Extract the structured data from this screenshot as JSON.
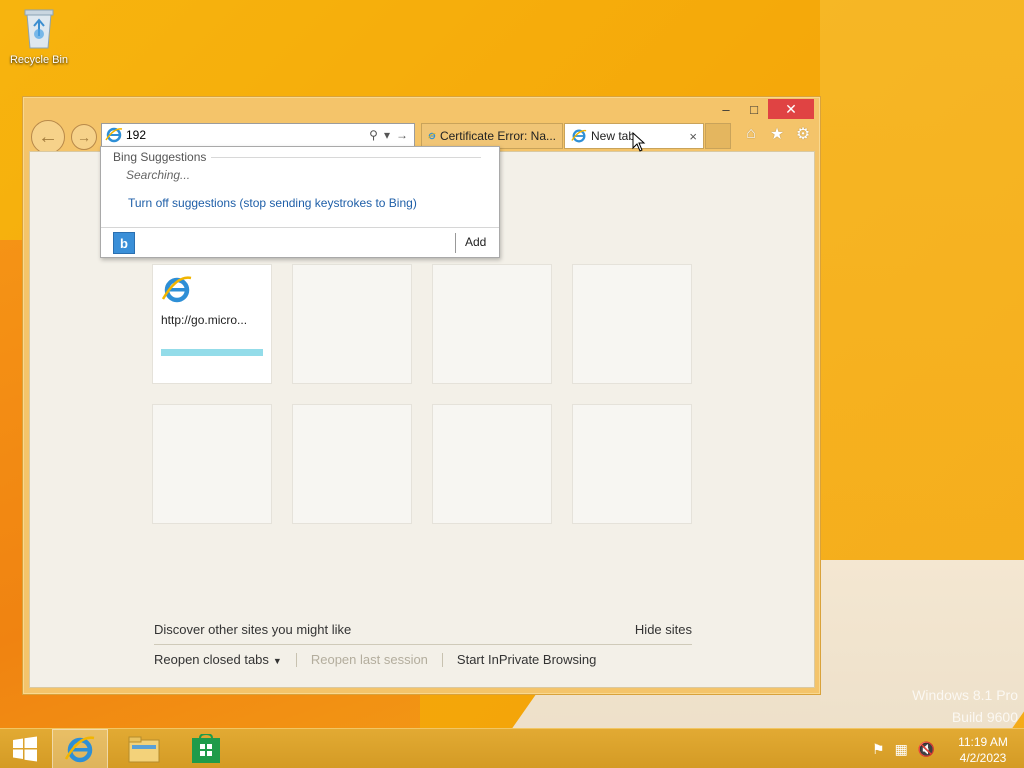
{
  "desktop": {
    "recycle_bin_label": "Recycle Bin",
    "watermark_line1": "Windows 8.1 Pro",
    "watermark_line2": "Build 9600"
  },
  "window": {
    "minimize": "–",
    "maximize": "□",
    "close": "✕"
  },
  "address_bar": {
    "value": "192"
  },
  "tabs": [
    {
      "label": "Certificate Error: Na..."
    },
    {
      "label": "New tab",
      "close": "×"
    }
  ],
  "suggestions": {
    "header": "Bing Suggestions",
    "status": "Searching...",
    "turn_off": "Turn off suggestions (stop sending keystrokes to Bing)",
    "add": "Add",
    "bing_logo": "b"
  },
  "tiles": [
    {
      "label": "http://go.micro...",
      "icon": "ie-icon",
      "progress": 1.0
    }
  ],
  "footer": {
    "discover": "Discover other sites you might like",
    "hide_sites": "Hide sites",
    "reopen_closed": "Reopen closed tabs",
    "reopen_last": "Reopen last session",
    "inprivate": "Start InPrivate Browsing"
  },
  "taskbar": {
    "time": "11:19 AM",
    "date": "4/2/2023"
  }
}
